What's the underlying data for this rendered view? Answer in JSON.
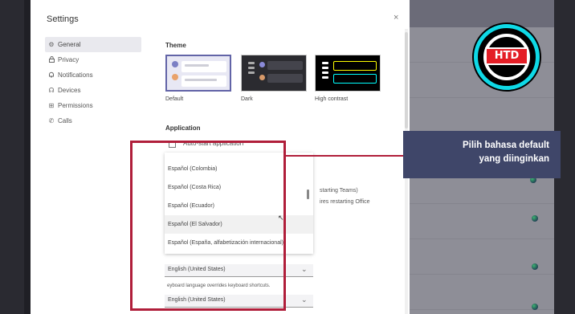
{
  "dialog": {
    "title": "Settings",
    "close_glyph": "×"
  },
  "nav": {
    "items": [
      {
        "label": "General",
        "icon": "gear-icon",
        "glyph": "⚙",
        "active": true
      },
      {
        "label": "Privacy",
        "icon": "lock-icon",
        "glyph": "🔒",
        "active": false
      },
      {
        "label": "Notifications",
        "icon": "bell-icon",
        "glyph": "🔔",
        "active": false
      },
      {
        "label": "Devices",
        "icon": "headset-icon",
        "glyph": "☊",
        "active": false
      },
      {
        "label": "Permissions",
        "icon": "grid-icon",
        "glyph": "⊞",
        "active": false
      },
      {
        "label": "Calls",
        "icon": "phone-icon",
        "glyph": "✆",
        "active": false
      }
    ]
  },
  "theme": {
    "heading": "Theme",
    "options": [
      {
        "label": "Default",
        "selected": true
      },
      {
        "label": "Dark",
        "selected": false
      },
      {
        "label": "High contrast",
        "selected": false
      }
    ]
  },
  "application": {
    "heading": "Application",
    "auto_start_label": "Auto-start application",
    "peek_text_1": "starting Teams)",
    "peek_text_2": "ires restarting Office"
  },
  "language_list": {
    "items": [
      "Español (Colombia)",
      "Español (Costa Rica)",
      "Español (Ecuador)",
      "Español (El Salvador)",
      "Español (España, alfabetización internacional)"
    ],
    "hovered_index": 3
  },
  "language": {
    "app_language_value": "English (United States)",
    "keyboard_note": "eyboard language overrides keyboard shortcuts.",
    "keyboard_language_value": "English (United States)",
    "chevron": "⌄"
  },
  "callout": {
    "line1": "Pilih bahasa default",
    "line2": "yang diinginkan"
  },
  "logo": {
    "text": "HTD"
  },
  "colors": {
    "accent": "#6264a7",
    "highlight_red": "#b01e3a",
    "callout_bg": "#3f4669",
    "logo_ring": "#0fd9e6",
    "logo_red": "#e41e26"
  }
}
